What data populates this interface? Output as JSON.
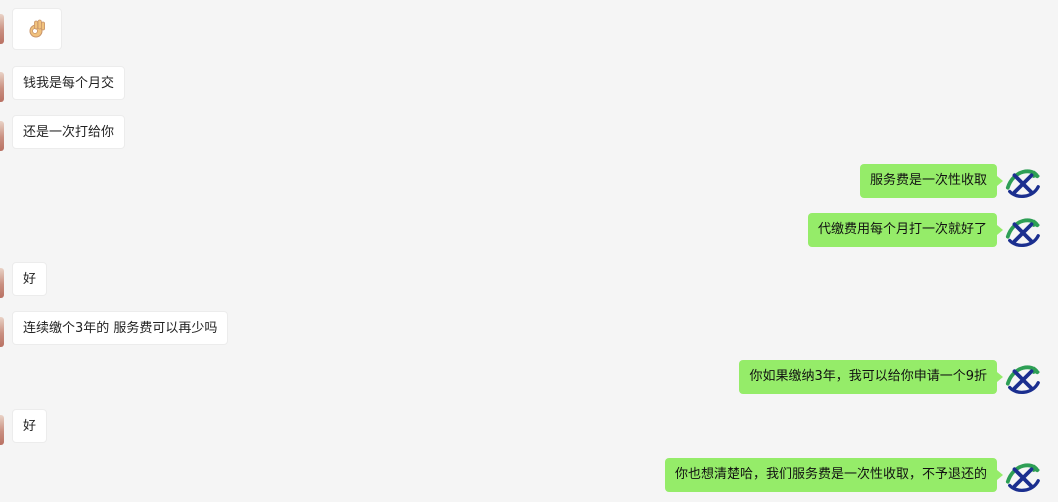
{
  "conversation": {
    "emoji_message": "ok-hand-emoji",
    "messages": [
      {
        "side": "in",
        "text": "钱我是每个月交"
      },
      {
        "side": "in",
        "text": "还是一次打给你"
      },
      {
        "side": "out",
        "text": "服务费是一次性收取"
      },
      {
        "side": "out",
        "text": "代缴费用每个月打一次就好了"
      },
      {
        "side": "in",
        "text": "好"
      },
      {
        "side": "in",
        "text": "连续缴个3年的 服务费可以再少吗"
      },
      {
        "side": "out",
        "text": "你如果缴纳3年，我可以给你申请一个9折"
      },
      {
        "side": "in",
        "text": "好"
      },
      {
        "side": "out",
        "text": "你也想清楚哈，我们服务费是一次性收取，不予退还的"
      }
    ]
  },
  "colors": {
    "background": "#f5f5f5",
    "incoming_bubble": "#ffffff",
    "outgoing_bubble": "#95ec69",
    "logo_green": "#2e9f55",
    "logo_blue": "#1b2f8f"
  }
}
